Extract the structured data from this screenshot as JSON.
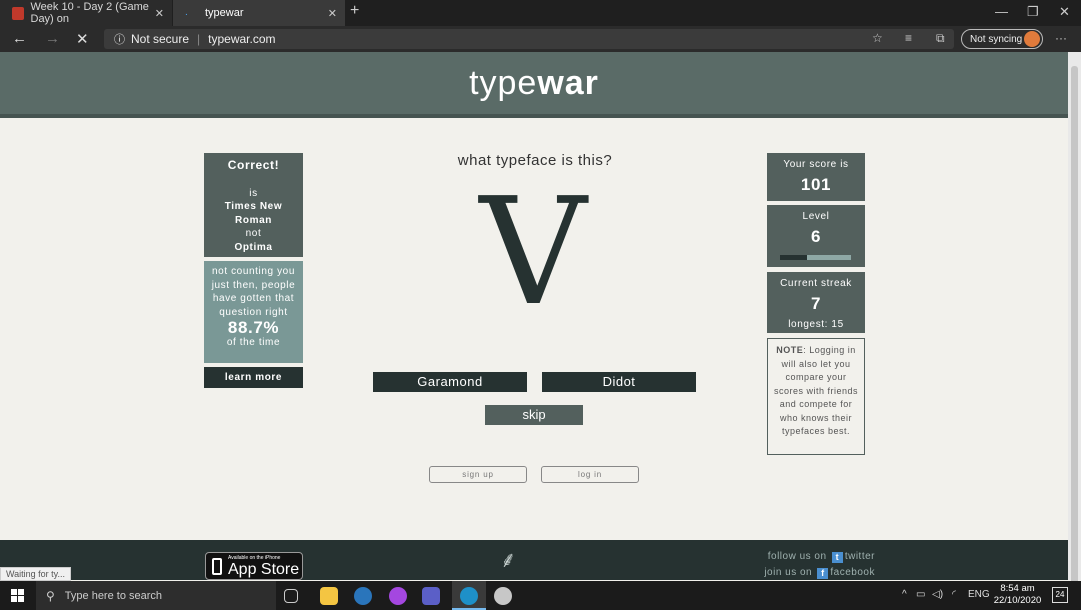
{
  "browser": {
    "tabs": [
      {
        "title": "Week 10 - Day 2 (Game Day) on",
        "active": false
      },
      {
        "title": "typewar",
        "active": true
      }
    ],
    "security_label": "Not secure",
    "url": "typewar.com",
    "sync_label": "Not syncing",
    "status_message": "Waiting for ty..."
  },
  "header": {
    "logo_light": "type",
    "logo_bold": "war"
  },
  "result_panel": {
    "heading": "Correct!",
    "is_text": "is",
    "correct_font_line1": "Times New",
    "correct_font_line2": "Roman",
    "not_text": "not",
    "wrong_font": "Optima"
  },
  "stats_panel": {
    "line1": "not counting you",
    "line2": "just then, people",
    "line3": "have gotten that",
    "line4": "question right",
    "percent": "88.7%",
    "suffix": "of the time",
    "learn_more": "learn more"
  },
  "question": {
    "prompt": "what typeface is this?",
    "glyph": "V",
    "choices": [
      "Garamond",
      "Didot"
    ],
    "skip_label": "skip"
  },
  "auth": {
    "signup_label": "sign up",
    "login_label": "log in"
  },
  "score_panel": {
    "label": "Your score is",
    "value": "101"
  },
  "level_panel": {
    "label": "Level",
    "value": "6",
    "progress_fraction": 0.38
  },
  "streak_panel": {
    "label": "Current streak",
    "value": "7",
    "longest": "longest: 15"
  },
  "note": {
    "prefix": "NOTE",
    "text": ": Logging in will also let you compare your scores with friends and compete for who knows their typefaces best."
  },
  "footer": {
    "appstore_small": "Available on the iPhone",
    "appstore_big": "App Store",
    "twitter_prefix": "follow us on",
    "twitter_label": "twitter",
    "facebook_prefix": "join us on",
    "facebook_label": "facebook"
  },
  "taskbar": {
    "search_placeholder": "Type here to search",
    "language": "ENG",
    "time": "8:54 am",
    "date": "22/10/2020",
    "notification_count": "24"
  },
  "colors": {
    "header": "#5a6b67",
    "panel_dark": "#53605d",
    "panel_teal": "#7a9896",
    "button_dark": "#263231"
  }
}
